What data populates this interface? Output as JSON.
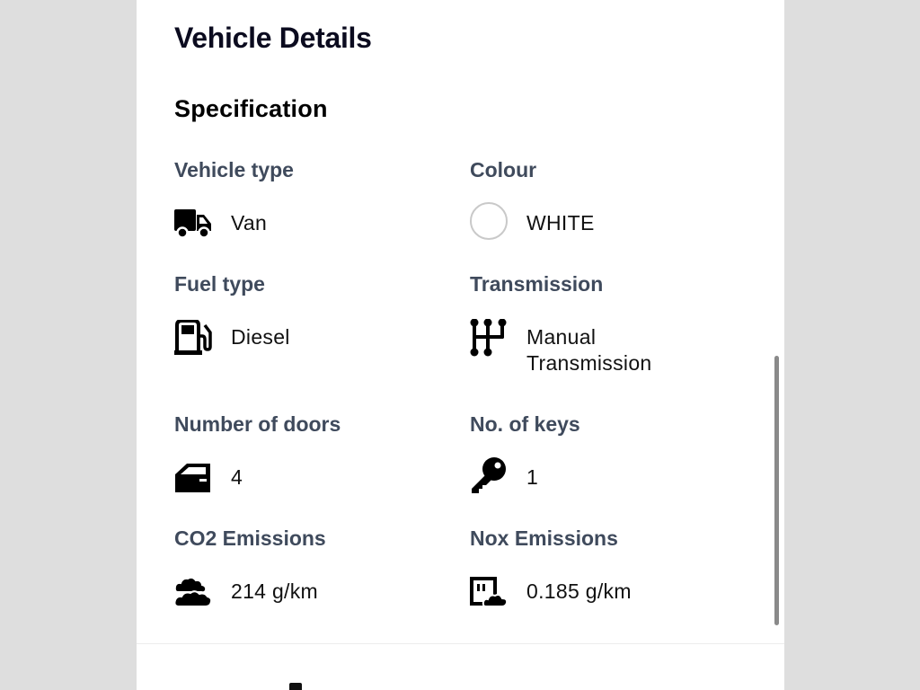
{
  "page": {
    "title": "Vehicle Details"
  },
  "specification": {
    "heading": "Specification",
    "items": [
      {
        "label": "Vehicle type",
        "value": "Van",
        "icon": "van-icon"
      },
      {
        "label": "Colour",
        "value": "WHITE",
        "icon": "colour-swatch",
        "swatch_color": "#ffffff"
      },
      {
        "label": "Fuel type",
        "value": "Diesel",
        "icon": "fuel-pump-icon"
      },
      {
        "label": "Transmission",
        "value_line1": "Manual",
        "value_line2": "Transmission",
        "icon": "gear-shift-icon"
      },
      {
        "label": "Number of doors",
        "value": "4",
        "icon": "car-door-icon"
      },
      {
        "label": "No. of keys",
        "value": "1",
        "icon": "key-icon"
      },
      {
        "label": "CO2 Emissions",
        "value": "214 g/km",
        "icon": "clouds-icon"
      },
      {
        "label": "Nox Emissions",
        "value": "0.185 g/km",
        "icon": "emissions-meter-icon"
      }
    ]
  },
  "colors": {
    "label": "#3f4a5c",
    "title": "#0b0b1f",
    "panel": "#ffffff",
    "background": "#dedede"
  }
}
